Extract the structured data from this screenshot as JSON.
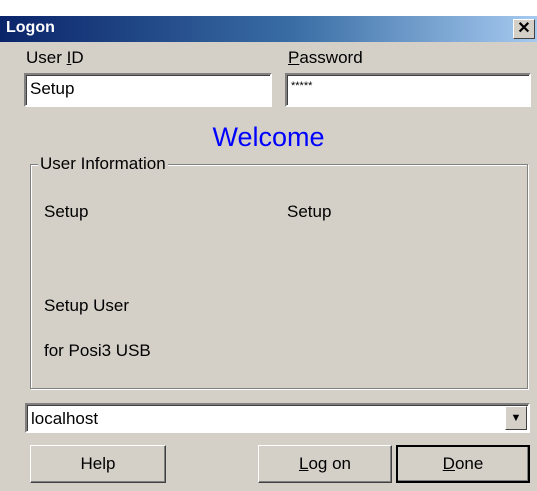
{
  "window": {
    "title": "Logon",
    "close_glyph": "✕"
  },
  "form": {
    "user_id_label_pre": "User ",
    "user_id_label_key": "I",
    "user_id_label_post": "D",
    "user_id_value": "Setup",
    "password_label_key": "P",
    "password_label_post": "assword",
    "password_value": "*****"
  },
  "welcome_text": "Welcome",
  "user_information": {
    "legend": "User Information",
    "field1": "Setup",
    "field2": "Setup",
    "full_name": "Setup User",
    "description": "for Posi3 USB"
  },
  "server": {
    "selected": "localhost",
    "dropdown_icon": "chevron-down-icon"
  },
  "buttons": {
    "help": "Help",
    "logon_key": "L",
    "logon_post": "og on",
    "done_key": "D",
    "done_post": "one"
  }
}
